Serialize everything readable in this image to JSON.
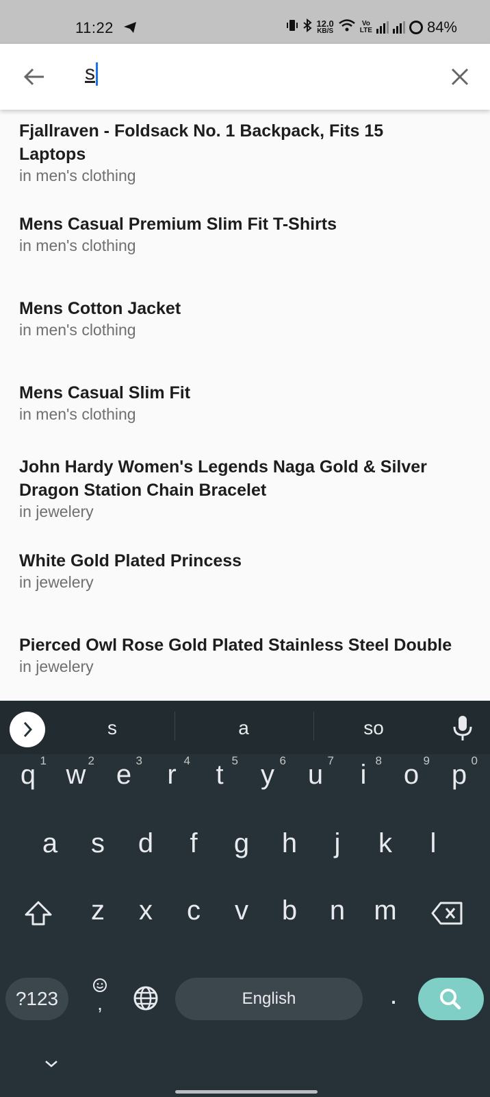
{
  "status_bar": {
    "time": "11:22",
    "net_speed_value": "12.0",
    "net_speed_unit": "KB/S",
    "volte_top": "Vo",
    "volte_bottom": "LTE",
    "battery": "84%"
  },
  "search": {
    "query": "s"
  },
  "results": [
    {
      "title_line1": "Fjallraven - Foldsack No. 1 Backpack, Fits 15",
      "title_line2": "Laptops",
      "category": "in men's clothing"
    },
    {
      "title_line1": "Mens Casual Premium Slim Fit T-Shirts",
      "title_line2": "",
      "category": "in men's clothing"
    },
    {
      "title_line1": "Mens Cotton Jacket",
      "title_line2": "",
      "category": "in men's clothing"
    },
    {
      "title_line1": "Mens Casual Slim Fit",
      "title_line2": "",
      "category": "in men's clothing"
    },
    {
      "title_line1": "John Hardy Women's Legends Naga Gold & Silver",
      "title_line2": "Dragon Station Chain Bracelet",
      "category": "in jewelery"
    },
    {
      "title_line1": "White Gold Plated Princess",
      "title_line2": "",
      "category": "in jewelery"
    },
    {
      "title_line1": "Pierced Owl Rose Gold Plated Stainless Steel Double",
      "title_line2": "",
      "category": "in jewelery"
    }
  ],
  "keyboard": {
    "suggestions": [
      "s",
      "a",
      "so"
    ],
    "row1": [
      {
        "key": "q",
        "hint": "1"
      },
      {
        "key": "w",
        "hint": "2"
      },
      {
        "key": "e",
        "hint": "3"
      },
      {
        "key": "r",
        "hint": "4"
      },
      {
        "key": "t",
        "hint": "5"
      },
      {
        "key": "y",
        "hint": "6"
      },
      {
        "key": "u",
        "hint": "7"
      },
      {
        "key": "i",
        "hint": "8"
      },
      {
        "key": "o",
        "hint": "9"
      },
      {
        "key": "p",
        "hint": "0"
      }
    ],
    "row2": [
      "a",
      "s",
      "d",
      "f",
      "g",
      "h",
      "j",
      "k",
      "l"
    ],
    "row3": [
      "z",
      "x",
      "c",
      "v",
      "b",
      "n",
      "m"
    ],
    "symbols_label": "?123",
    "comma": ",",
    "space_label": "English",
    "period": "."
  }
}
